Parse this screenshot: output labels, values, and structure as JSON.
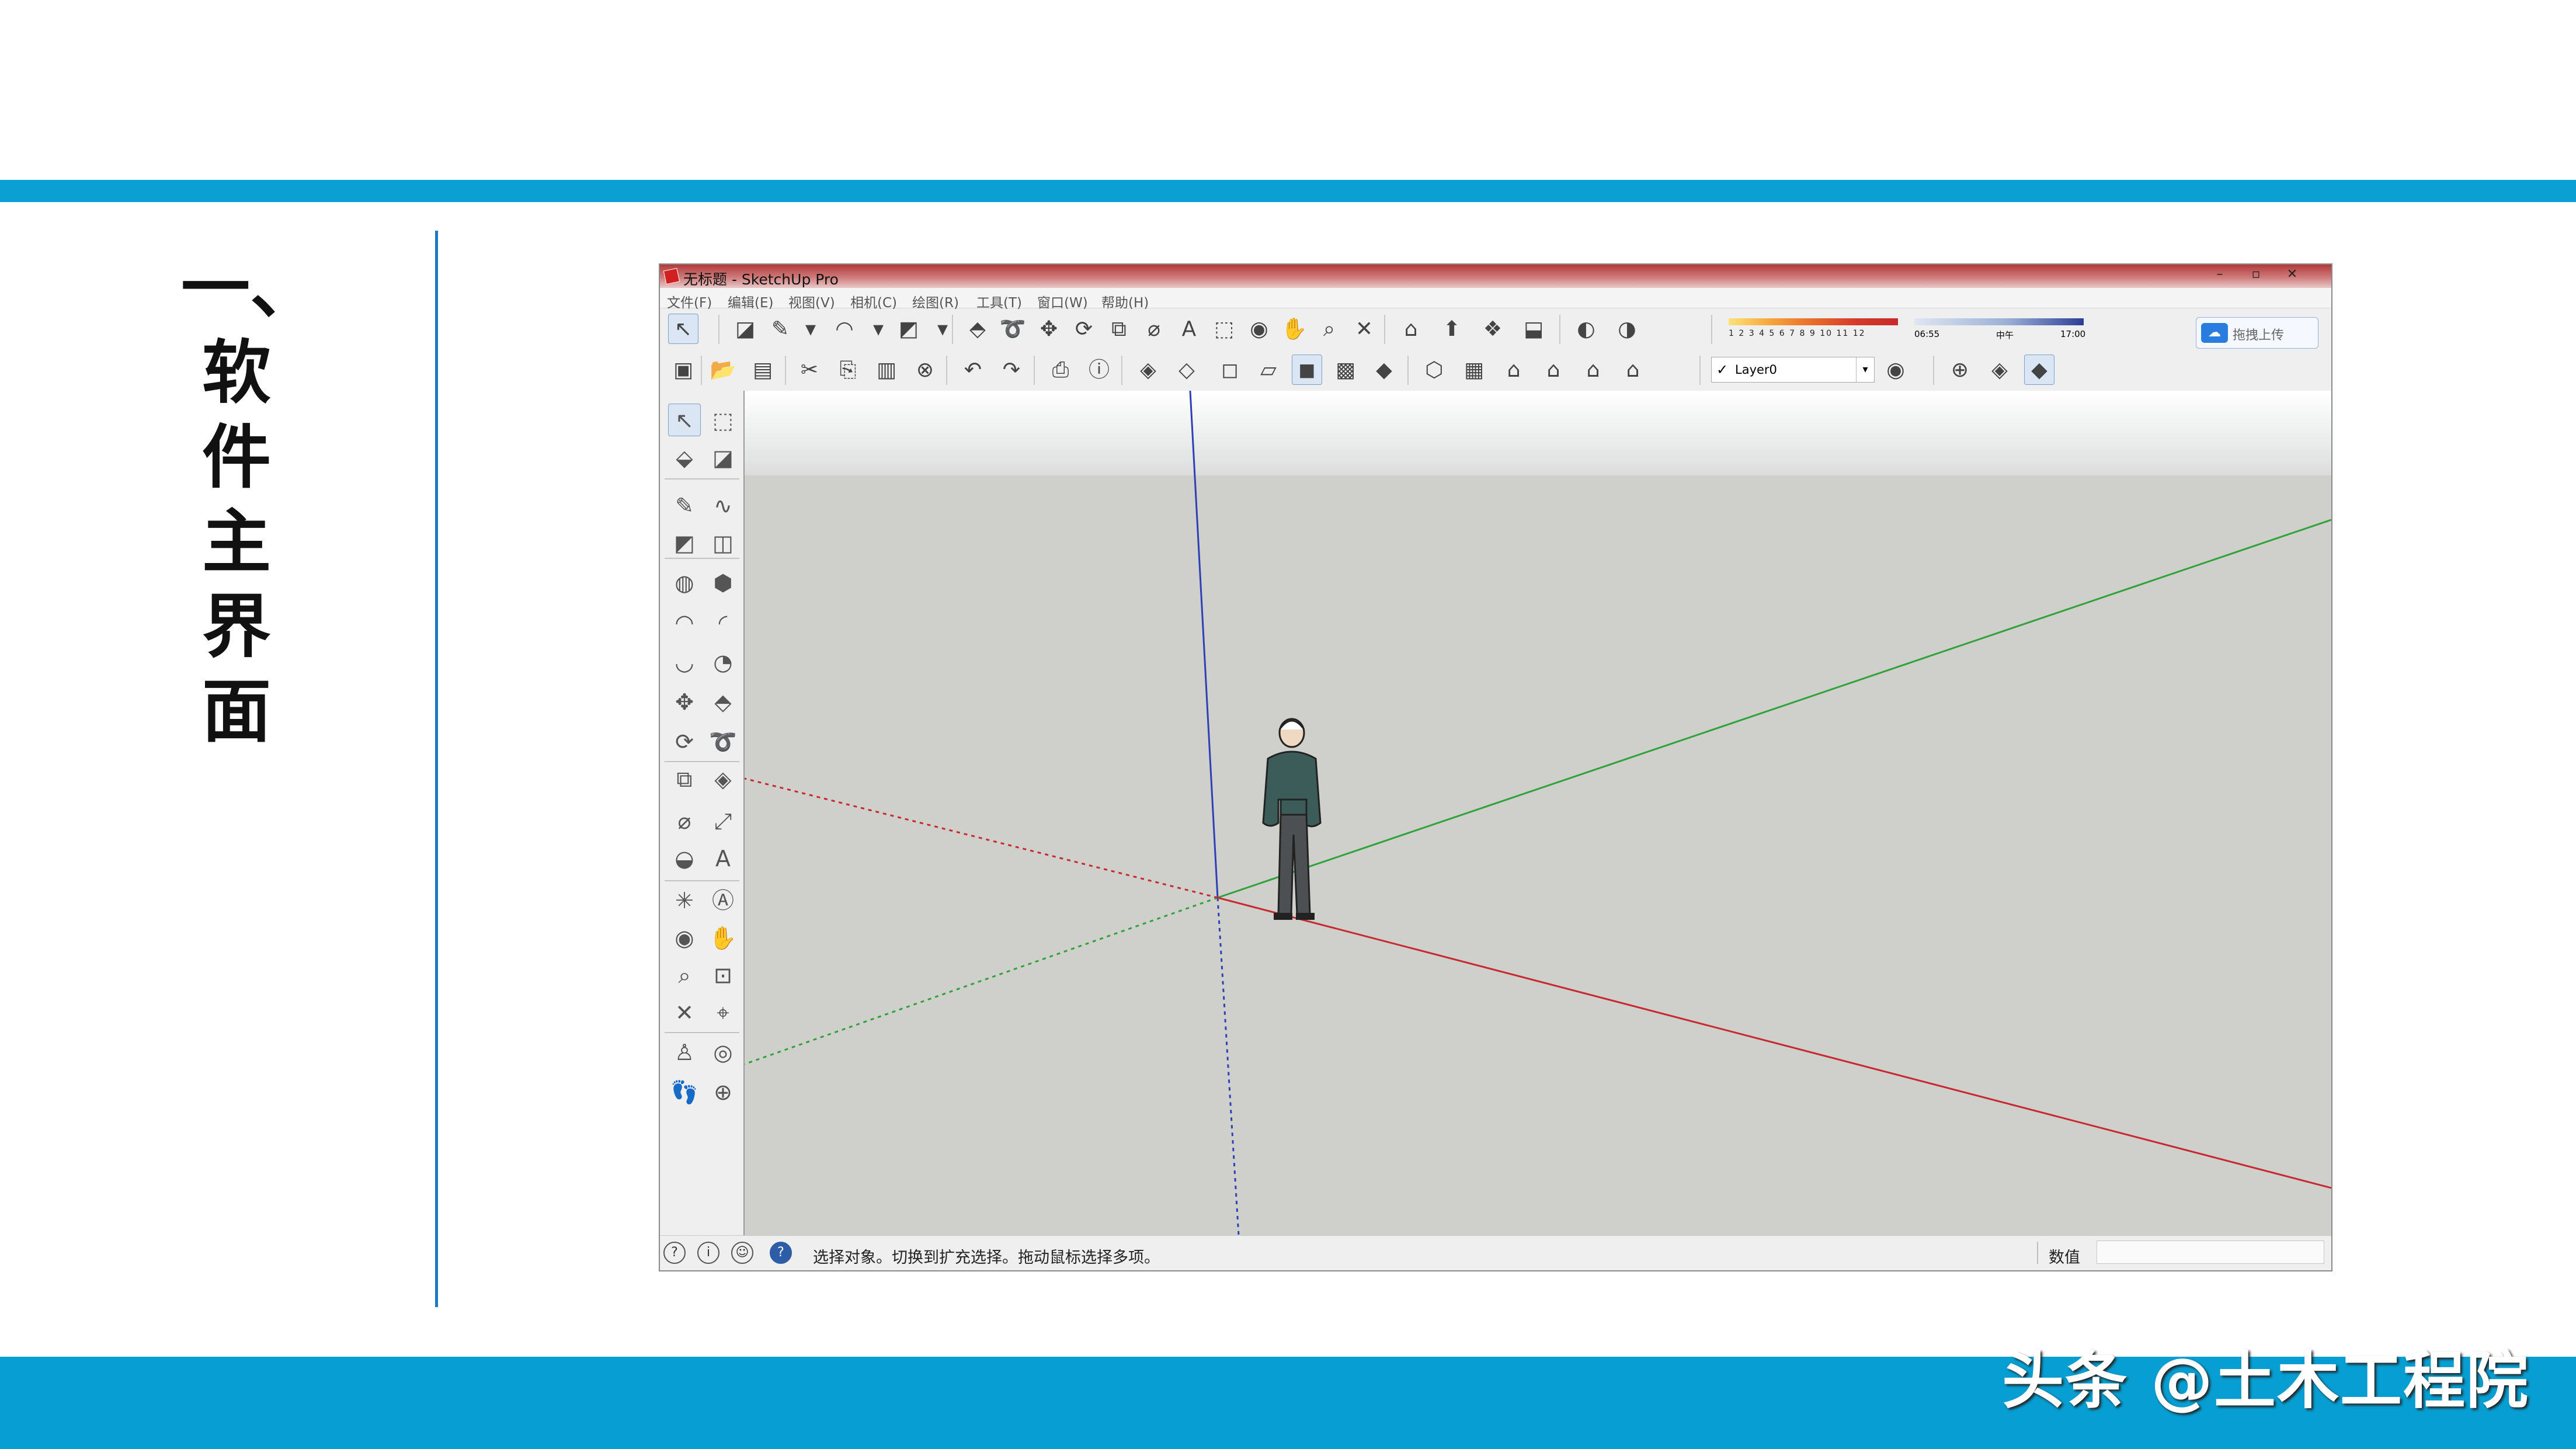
{
  "slide": {
    "title_chars": [
      "一、",
      "软",
      "件",
      "主",
      "界",
      "面"
    ],
    "watermark": "头条 @土木工程院"
  },
  "colors": {
    "accent_bar": "#0aa0d4",
    "divider": "#1e78c8",
    "axis_red": "#c8282f",
    "axis_green": "#2fa33a",
    "axis_blue": "#2f3fb5"
  },
  "app": {
    "title": "无标题 - SketchUp Pro",
    "window_controls": [
      "–",
      "▫",
      "✕"
    ],
    "menus": [
      "文件(F)",
      "编辑(E)",
      "视图(V)",
      "相机(C)",
      "绘图(R)",
      "工具(T)",
      "窗口(W)",
      "帮助(H)"
    ],
    "toolbar_row1": [
      {
        "name": "select-icon",
        "glyph": "↖"
      },
      {
        "name": "eraser-icon",
        "glyph": "◪"
      },
      {
        "name": "pencil-icon",
        "glyph": "✎"
      },
      {
        "name": "dropdown-arrow-icon",
        "glyph": "▾"
      },
      {
        "name": "arc-icon",
        "glyph": "◠"
      },
      {
        "name": "dropdown-arrow-icon",
        "glyph": "▾"
      },
      {
        "name": "rectangle-icon",
        "glyph": "◩"
      },
      {
        "name": "dropdown-arrow-icon",
        "glyph": "▾"
      },
      {
        "name": "push-pull-icon",
        "glyph": "⬘"
      },
      {
        "name": "follow-me-icon",
        "glyph": "➰"
      },
      {
        "name": "move-icon",
        "glyph": "✥"
      },
      {
        "name": "rotate-icon",
        "glyph": "⟳"
      },
      {
        "name": "scale-icon",
        "glyph": "⧉"
      },
      {
        "name": "tape-measure-icon",
        "glyph": "⌀"
      },
      {
        "name": "text-icon",
        "glyph": "A"
      },
      {
        "name": "paint-bucket-icon",
        "glyph": "⬚"
      },
      {
        "name": "orbit-icon",
        "glyph": "◉"
      },
      {
        "name": "pan-icon",
        "glyph": "✋"
      },
      {
        "name": "zoom-icon",
        "glyph": "⌕"
      },
      {
        "name": "zoom-extents-icon",
        "glyph": "✕"
      },
      {
        "name": "warehouse-icon",
        "glyph": "⌂"
      },
      {
        "name": "share-model-icon",
        "glyph": "⬆"
      },
      {
        "name": "components-icon",
        "glyph": "❖"
      },
      {
        "name": "extension-icon",
        "glyph": "⬓"
      },
      {
        "name": "shadows-toggle-icon",
        "glyph": "◐"
      },
      {
        "name": "fog-icon",
        "glyph": "◑"
      }
    ],
    "shadow_months": "1 2 3 4 5 6 7 8 9 10 11 12",
    "time_labels": [
      "06:55",
      "中午",
      "17:00"
    ],
    "toolbar_row2": [
      {
        "name": "new-file-icon",
        "glyph": "▣"
      },
      {
        "name": "open-file-icon",
        "glyph": "📂"
      },
      {
        "name": "save-icon",
        "glyph": "▤"
      },
      {
        "name": "cut-icon",
        "glyph": "✂"
      },
      {
        "name": "copy-icon",
        "glyph": "⎘"
      },
      {
        "name": "paste-icon",
        "glyph": "▥"
      },
      {
        "name": "delete-icon",
        "glyph": "⊗"
      },
      {
        "name": "undo-icon",
        "glyph": "↶"
      },
      {
        "name": "redo-icon",
        "glyph": "↷"
      },
      {
        "name": "print-icon",
        "glyph": "⎙"
      },
      {
        "name": "model-info-icon",
        "glyph": "ⓘ"
      },
      {
        "name": "xray-icon",
        "glyph": "◈"
      },
      {
        "name": "back-edges-icon",
        "glyph": "◇"
      },
      {
        "name": "wireframe-icon",
        "glyph": "◻"
      },
      {
        "name": "hidden-line-icon",
        "glyph": "▱"
      },
      {
        "name": "shaded-icon",
        "glyph": "◼"
      },
      {
        "name": "shaded-textures-icon",
        "glyph": "▩"
      },
      {
        "name": "monochrome-icon",
        "glyph": "◆"
      },
      {
        "name": "iso-view-icon",
        "glyph": "⬡"
      },
      {
        "name": "top-view-icon",
        "glyph": "▦"
      },
      {
        "name": "front-view-icon",
        "glyph": "⌂"
      },
      {
        "name": "right-view-icon",
        "glyph": "⌂"
      },
      {
        "name": "back-view-icon",
        "glyph": "⌂"
      },
      {
        "name": "left-view-icon",
        "glyph": "⌂"
      }
    ],
    "layer": {
      "check": "✓",
      "current": "Layer0",
      "dropdown": "▾"
    },
    "upload": {
      "icon": "☁",
      "label": "拖拽上传"
    },
    "left_tools": [
      {
        "name": "select-icon",
        "glyph": "↖"
      },
      {
        "name": "make-component-icon",
        "glyph": "⬚"
      },
      {
        "name": "paint-bucket-icon",
        "glyph": "⬙"
      },
      {
        "name": "eraser-icon",
        "glyph": "◪"
      },
      {
        "name": "line-icon",
        "glyph": "✎"
      },
      {
        "name": "freehand-icon",
        "glyph": "∿"
      },
      {
        "name": "rectangle-icon",
        "glyph": "◩"
      },
      {
        "name": "rotated-rectangle-icon",
        "glyph": "◫"
      },
      {
        "name": "circle-icon",
        "glyph": "◍"
      },
      {
        "name": "polygon-icon",
        "glyph": "⬢"
      },
      {
        "name": "arc-icon",
        "glyph": "◠"
      },
      {
        "name": "arc-2-icon",
        "glyph": "◜"
      },
      {
        "name": "arc-3-icon",
        "glyph": "◡"
      },
      {
        "name": "pie-icon",
        "glyph": "◔"
      },
      {
        "name": "move-icon",
        "glyph": "✥"
      },
      {
        "name": "push-pull-icon",
        "glyph": "⬘"
      },
      {
        "name": "rotate-icon",
        "glyph": "⟳"
      },
      {
        "name": "follow-me-icon",
        "glyph": "➰"
      },
      {
        "name": "scale-icon",
        "glyph": "⧉"
      },
      {
        "name": "offset-icon",
        "glyph": "◈"
      },
      {
        "name": "tape-measure-icon",
        "glyph": "⌀"
      },
      {
        "name": "dimension-icon",
        "glyph": "⤢"
      },
      {
        "name": "protractor-icon",
        "glyph": "◒"
      },
      {
        "name": "text-icon",
        "glyph": "A"
      },
      {
        "name": "axes-icon",
        "glyph": "✳"
      },
      {
        "name": "3d-text-icon",
        "glyph": "Ⓐ"
      },
      {
        "name": "orbit-icon",
        "glyph": "◉"
      },
      {
        "name": "pan-icon",
        "glyph": "✋"
      },
      {
        "name": "zoom-icon",
        "glyph": "⌕"
      },
      {
        "name": "zoom-window-icon",
        "glyph": "⊡"
      },
      {
        "name": "zoom-extents-icon",
        "glyph": "✕"
      },
      {
        "name": "previous-view-icon",
        "glyph": "⌖"
      },
      {
        "name": "position-camera-icon",
        "glyph": "♙"
      },
      {
        "name": "look-around-icon",
        "glyph": "◎"
      },
      {
        "name": "walk-icon",
        "glyph": "👣"
      },
      {
        "name": "section-plane-icon",
        "glyph": "⊕"
      }
    ],
    "status": {
      "icons": [
        {
          "name": "geolocation-icon",
          "glyph": "?"
        },
        {
          "name": "credits-icon",
          "glyph": "i"
        },
        {
          "name": "user-account-icon",
          "glyph": "☺"
        },
        {
          "name": "help-icon",
          "glyph": "?"
        }
      ],
      "message": "选择对象。切换到扩充选择。拖动鼠标选择多项。",
      "measurements_label": "数值",
      "measurements_value": ""
    }
  }
}
